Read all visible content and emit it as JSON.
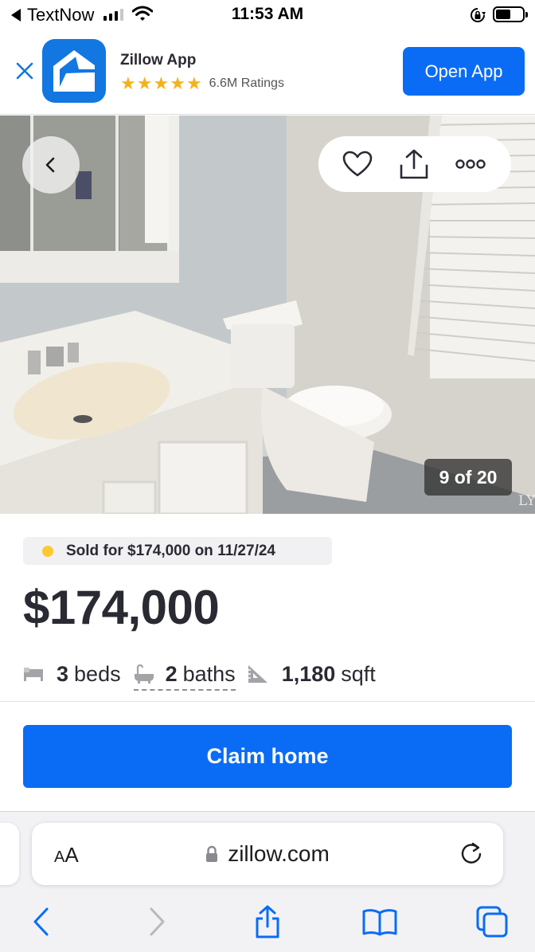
{
  "status_bar": {
    "back_app": "TextNow",
    "time": "11:53 AM",
    "signal_bars": 4,
    "signal_active": 3
  },
  "app_banner": {
    "title": "Zillow App",
    "stars": 5,
    "ratings": "6.6M Ratings",
    "open_label": "Open App",
    "star_color": "#f3b21c",
    "logo_color": "#1277e1"
  },
  "photo": {
    "counter": "9 of 20",
    "watermark": "LY",
    "actions": [
      "heart-icon",
      "share-icon",
      "more-icon"
    ]
  },
  "listing": {
    "status_text": "Sold for $174,000 on 11/27/24",
    "status_dot_color": "#fdc92f",
    "price": "$174,000",
    "beds_value": "3",
    "beds_label": "beds",
    "baths_value": "2",
    "baths_label": "baths",
    "sqft_value": "1,180",
    "sqft_label": "sqft"
  },
  "cta": {
    "claim_label": "Claim home",
    "accent": "#0a6cf5"
  },
  "browser": {
    "aa_small": "A",
    "aa_large": "A",
    "url": "zillow.com",
    "toolbar": [
      "back-icon",
      "forward-icon",
      "share-icon",
      "bookmarks-icon",
      "tabs-icon"
    ]
  }
}
